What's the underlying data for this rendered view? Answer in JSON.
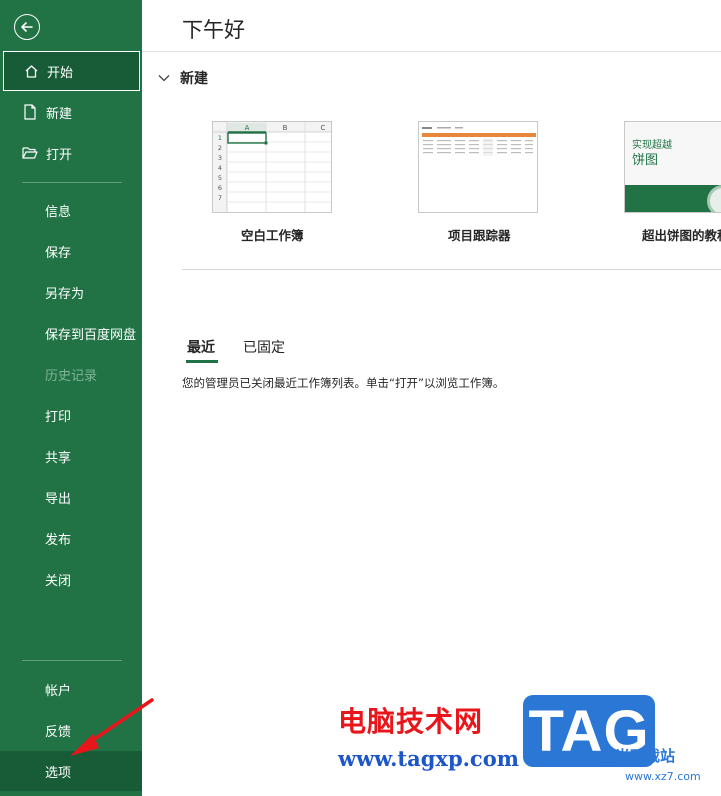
{
  "sidebar": {
    "items": [
      {
        "label": "开始",
        "icon": "home-icon"
      },
      {
        "label": "新建",
        "icon": "document-icon"
      },
      {
        "label": "打开",
        "icon": "folder-open-icon"
      },
      {
        "label": "信息"
      },
      {
        "label": "保存"
      },
      {
        "label": "另存为"
      },
      {
        "label": "保存到百度网盘"
      },
      {
        "label": "历史记录"
      },
      {
        "label": "打印"
      },
      {
        "label": "共享"
      },
      {
        "label": "导出"
      },
      {
        "label": "发布"
      },
      {
        "label": "关闭"
      }
    ],
    "bottom_items": [
      {
        "label": "帐户"
      },
      {
        "label": "反馈"
      },
      {
        "label": "选项"
      }
    ],
    "colors": {
      "background": "#217346",
      "active": "#185c37"
    }
  },
  "main": {
    "greeting": "下午好",
    "new_section": {
      "title": "新建",
      "templates": [
        {
          "name": "空白工作簿",
          "cols": [
            "A",
            "B",
            "C"
          ],
          "rows": [
            "1",
            "2",
            "3",
            "4",
            "5",
            "6",
            "7"
          ]
        },
        {
          "name": "项目跟踪器"
        },
        {
          "name": "超出饼图的教程",
          "thumb_text_1": "实现超越",
          "thumb_text_2": "饼图"
        }
      ]
    },
    "tabs": [
      {
        "label": "最近"
      },
      {
        "label": "已固定"
      }
    ],
    "recent_message": "您的管理员已关闭最近工作簿列表。单击“打开”以浏览工作簿。"
  },
  "watermark": {
    "cn_text": "电脑技术网",
    "url": "www.tagxp.com",
    "logo": "TAG",
    "site_text": "极光下载站",
    "site_url": "www.xz7.com"
  }
}
